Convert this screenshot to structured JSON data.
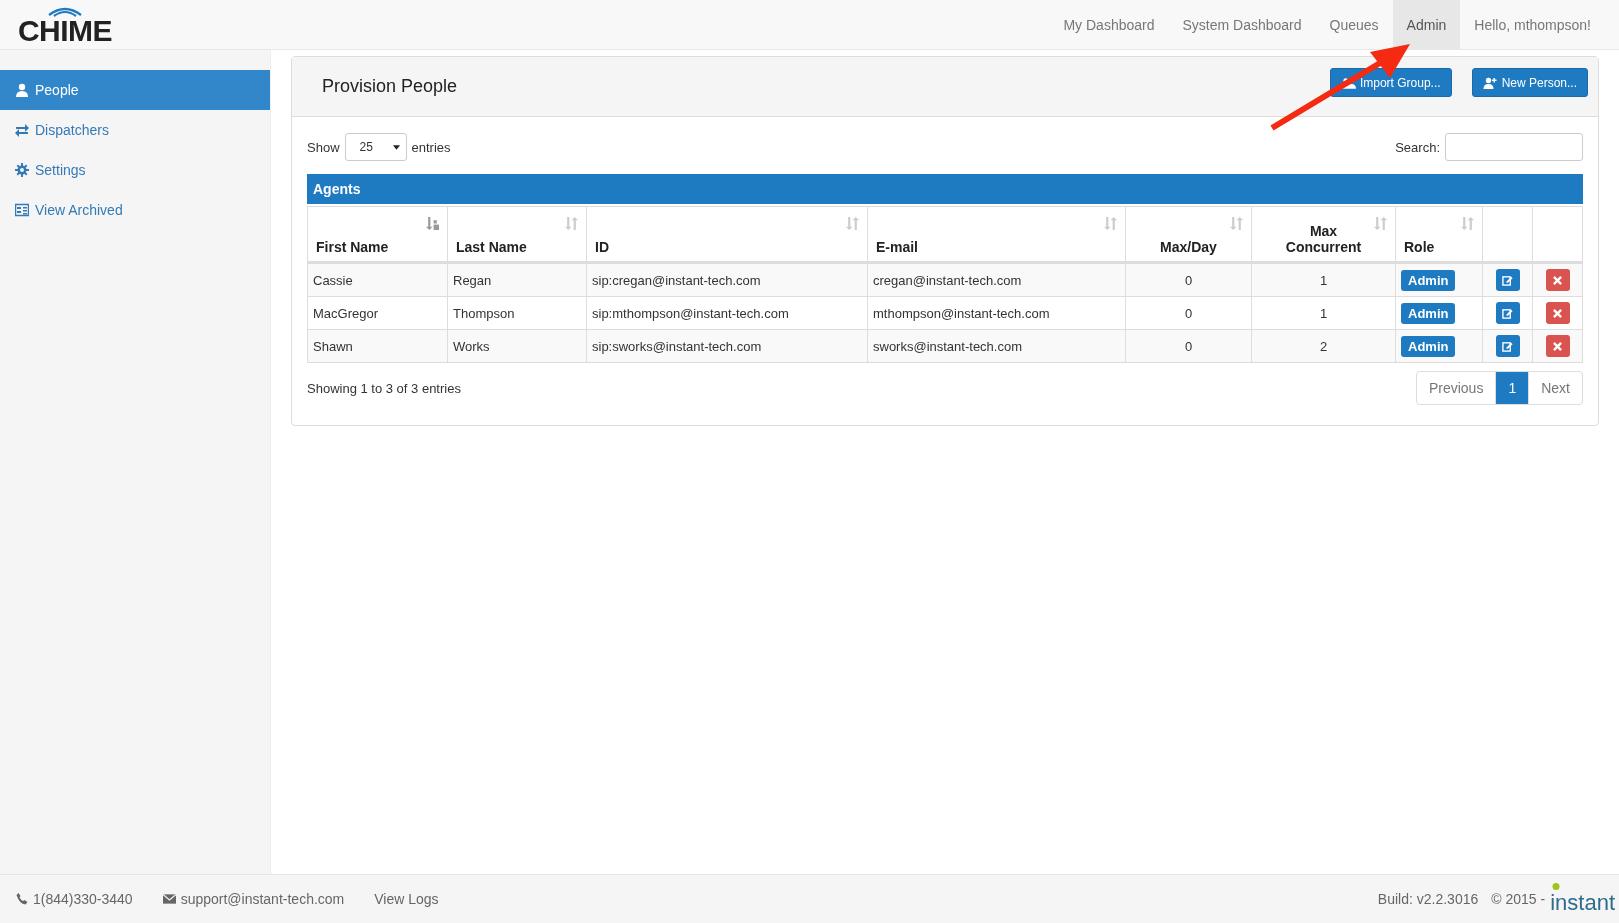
{
  "header": {
    "logo": "CHIME",
    "nav": [
      {
        "label": "My Dashboard",
        "selected": false
      },
      {
        "label": "System Dashboard",
        "selected": false
      },
      {
        "label": "Queues",
        "selected": false
      },
      {
        "label": "Admin",
        "selected": true
      },
      {
        "label": "Hello, mthompson!",
        "selected": false
      }
    ]
  },
  "sidebar": {
    "items": [
      {
        "label": "People",
        "selected": true
      },
      {
        "label": "Dispatchers",
        "selected": false
      },
      {
        "label": "Settings",
        "selected": false
      },
      {
        "label": "View Archived",
        "selected": false
      }
    ]
  },
  "panel": {
    "title": "Provision People",
    "buttons": [
      "Import Group...",
      "New Person..."
    ],
    "length_label_before": "Show",
    "length_value": "25",
    "length_label_after": "entries",
    "search_label": "Search:",
    "table": {
      "caption": "Agents",
      "columns": [
        {
          "label": "First Name",
          "sorted": true
        },
        {
          "label": "Last Name",
          "sorted": false
        },
        {
          "label": "ID",
          "sorted": false
        },
        {
          "label": "E-mail",
          "sorted": false
        },
        {
          "label": "Max/Day",
          "sorted": false
        },
        {
          "label": "Max Concurrent",
          "sorted": false
        },
        {
          "label": "Role",
          "sorted": false
        }
      ],
      "rows": [
        {
          "cells": [
            "Cassie",
            "Regan",
            "sip:cregan@instant-tech.com",
            "cregan@instant-tech.com",
            "0",
            "1"
          ],
          "role": "Admin"
        },
        {
          "cells": [
            "MacGregor",
            "Thompson",
            "sip:mthompson@instant-tech.com",
            "mthompson@instant-tech.com",
            "0",
            "1"
          ],
          "role": "Admin"
        },
        {
          "cells": [
            "Shawn",
            "Works",
            "sip:sworks@instant-tech.com",
            "sworks@instant-tech.com",
            "0",
            "2"
          ],
          "role": "Admin"
        }
      ]
    },
    "info": "Showing 1 to 3 of 3 entries",
    "pagination": [
      {
        "label": "Previous",
        "selected": false
      },
      {
        "label": "1",
        "selected": true
      },
      {
        "label": "Next",
        "selected": false
      }
    ]
  },
  "footer": {
    "phone": "1(844)330-3440",
    "email": "support@instant-tech.com",
    "logs": "View Logs",
    "build": "Build: v2.2.3016",
    "copyright": "© 2015 -",
    "brand": "instant"
  }
}
